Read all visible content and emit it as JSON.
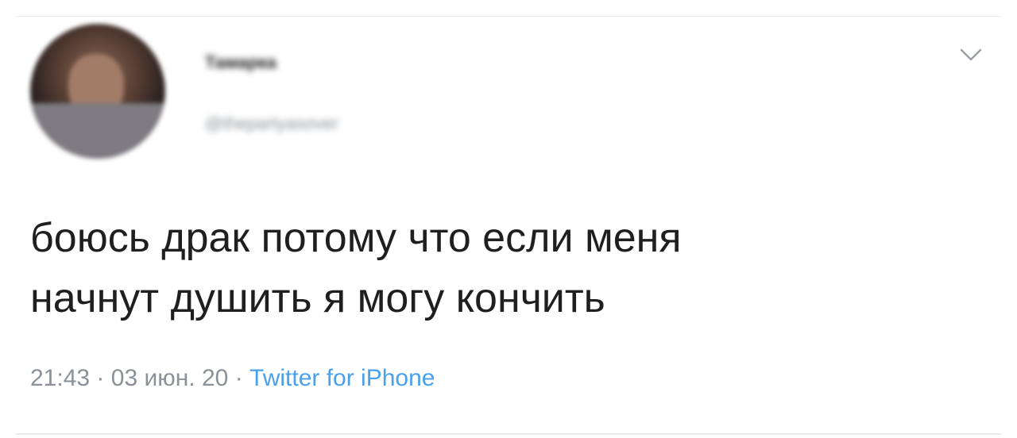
{
  "tweet": {
    "display_name": "Тамарка",
    "handle": "@thepartyasover",
    "text_lines": [
      "боюсь драк потому что если меня",
      "начнут душить я могу кончить"
    ],
    "time": "21:43",
    "separator": "·",
    "date": "03 июн. 20",
    "source": "Twitter for iPhone",
    "menu_icon": "chevron-down-icon"
  },
  "colors": {
    "text": "#1f1f1f",
    "meta": "#8a9199",
    "link": "#4aa1eb"
  }
}
